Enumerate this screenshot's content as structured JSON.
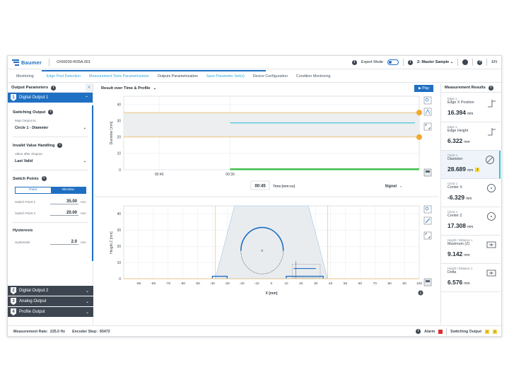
{
  "header": {
    "brand": "Baumer",
    "device": "OXM200-R05A.001",
    "expert_mode_label": "Expert Mode",
    "toggle_state": "ON",
    "sample_label": "2: Master Sample",
    "language": "EN"
  },
  "tabs": [
    {
      "label": "Monitoring",
      "group": false
    },
    {
      "label": "Edge Post Detection",
      "group": true
    },
    {
      "label": "Measurement Tools Parametrization",
      "group": true
    },
    {
      "label": "Outputs Parametrization",
      "group": true
    },
    {
      "label": "Save Parameter Set(s)",
      "group": true
    },
    {
      "label": "Device Configuration",
      "group": false
    },
    {
      "label": "Condition Monitoring",
      "group": false
    }
  ],
  "left_panel": {
    "title": "Output Parameters",
    "active_output": {
      "number": "1",
      "label": "Digital Output 1"
    },
    "switching_output": {
      "title": "Switching Output",
      "map_label": "Map Output to:",
      "map_value": "Circle 1 - Diameter"
    },
    "invalid_value": {
      "title": "Invalid Value Handling",
      "after_dropout_label": "Value after dropout",
      "after_dropout_value": "Last Valid"
    },
    "switch_points": {
      "title": "Switch Points",
      "mode_point": "Point",
      "mode_window": "Window",
      "sp1_label": "Switch Point 1",
      "sp1_value": "35.00",
      "sp2_label": "Switch Point 2",
      "sp2_value": "20.00",
      "unit": "mm"
    },
    "hysteresis": {
      "title": "Hysteresis",
      "label": "Hysteresis",
      "value": "2.0",
      "unit": "mm"
    },
    "other_outputs": [
      {
        "number": "2",
        "label": "Digital Output 2"
      },
      {
        "number": "3",
        "label": "Analog Output"
      },
      {
        "number": "4",
        "label": "Profile Output"
      }
    ]
  },
  "center": {
    "title": "Result over Time & Profile",
    "play_label": "Play",
    "time_value": "00:45",
    "time_unit": "Time [mm:ss]",
    "signal_label": "Signal"
  },
  "chart_data": [
    {
      "type": "line",
      "ylabel": "Diameter [mm]",
      "ylim": [
        0,
        45
      ],
      "yticks": [
        0,
        10,
        20,
        30,
        40
      ],
      "xticks": [
        "00:40",
        "00:30"
      ],
      "series": [
        {
          "color": "#33c3d9",
          "x": [
            "00:30",
            "00:45"
          ],
          "values": [
            28.689,
            28.689
          ]
        }
      ],
      "thresholds": [
        35,
        20
      ],
      "threshold_color": "#f0a830",
      "band": [
        20,
        35
      ],
      "valid_bar_color": "#3dbf4a",
      "grid": true
    },
    {
      "type": "line",
      "ylabel": "Height Z [mm]",
      "xlabel": "X [mm]",
      "xlim": [
        -100,
        100
      ],
      "ylim": [
        0,
        45
      ],
      "xticks": [
        -90,
        -80,
        -70,
        -60,
        -50,
        -40,
        -30,
        -20,
        -10,
        0,
        10,
        20,
        30,
        40,
        50,
        60,
        70,
        80,
        90,
        100
      ],
      "yticks": [
        0,
        10,
        20,
        30,
        40
      ],
      "circle": {
        "center_x": -6.329,
        "center_z": 17.308,
        "diameter": 28.689
      },
      "profile_color": "#1f6fc2",
      "grid": true
    }
  ],
  "right_panel": {
    "title": "Measurement Results",
    "items": [
      {
        "sub": "Edge 1",
        "name": "Edge X Position",
        "value": "16.394",
        "unit": "mm",
        "icon": "edge-x-icon",
        "selected": false,
        "warn": false
      },
      {
        "sub": "Edge 1",
        "name": "Edge Height",
        "value": "6.322",
        "unit": "mm",
        "icon": "edge-height-icon",
        "selected": false,
        "warn": false
      },
      {
        "sub": "Circle 1",
        "name": "Diameter",
        "value": "28.689",
        "unit": "mm",
        "icon": "circle-diameter-icon",
        "selected": true,
        "warn": true
      },
      {
        "sub": "Circle 1",
        "name": "Center X",
        "value": "-6.329",
        "unit": "mm",
        "icon": "circle-center-icon",
        "selected": false,
        "warn": false
      },
      {
        "sub": "Circle 1",
        "name": "Center Z",
        "value": "17.308",
        "unit": "mm",
        "icon": "circle-center-icon",
        "selected": false,
        "warn": false
      },
      {
        "sub": "Height / Distance 1",
        "name": "Maximum (Z)",
        "value": "9.142",
        "unit": "mm",
        "icon": "height-max-icon",
        "selected": false,
        "warn": false
      },
      {
        "sub": "Height / Distance 1",
        "name": "Delta",
        "value": "6.576",
        "unit": "mm",
        "icon": "height-delta-icon",
        "selected": false,
        "warn": false
      }
    ],
    "warn_badge": "!"
  },
  "status": {
    "rate_label": "Measurement Rate:",
    "rate_value": "225.0 Hz",
    "encoder_label": "Encoder Step:",
    "encoder_value": "65472",
    "alarm_label": "Alarm",
    "switching_label": "Switching Output",
    "sw1": "1",
    "sw2": "2"
  }
}
